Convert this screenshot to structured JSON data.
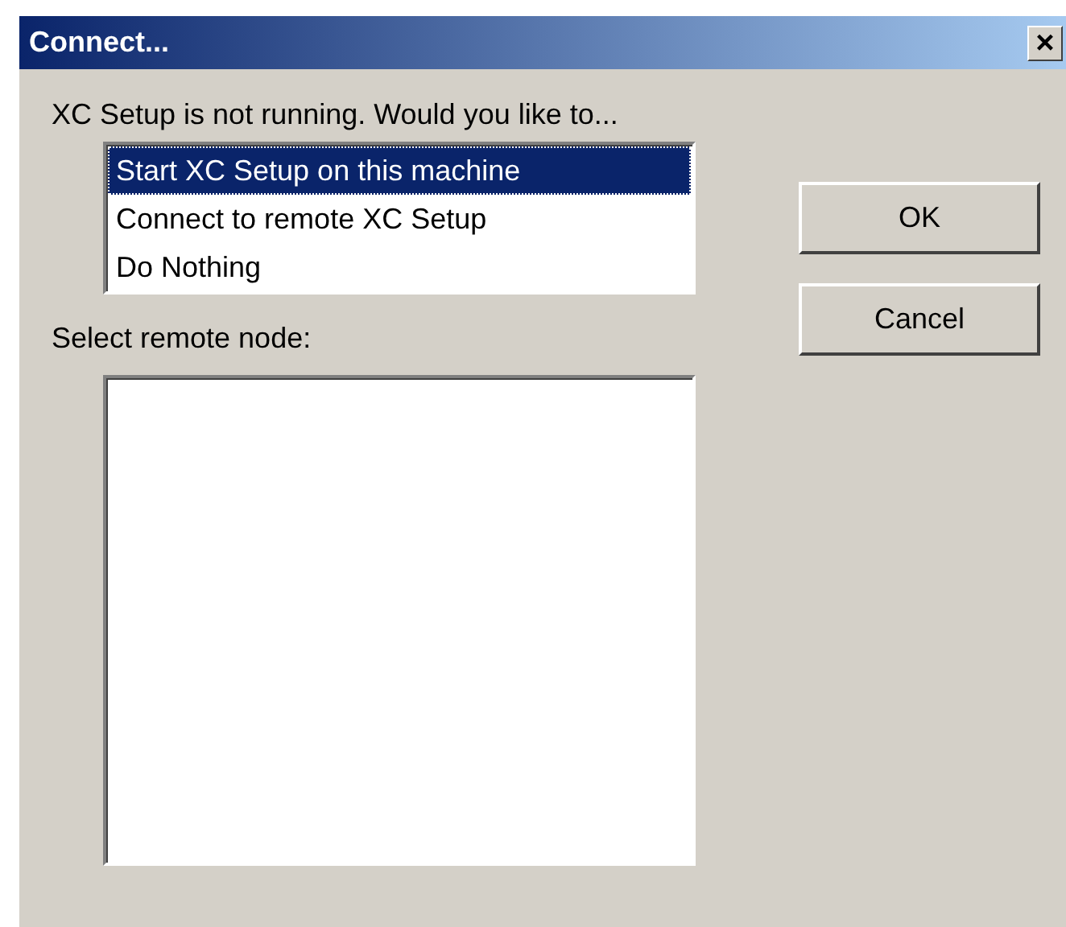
{
  "window": {
    "title": "Connect...",
    "close": "×"
  },
  "prompt": "XC Setup is not running.  Would you like to...",
  "options": [
    {
      "label": "Start XC Setup on this machine",
      "selected": true
    },
    {
      "label": "Connect to remote XC Setup",
      "selected": false
    },
    {
      "label": "Do Nothing",
      "selected": false
    }
  ],
  "node_label": "Select remote node:",
  "buttons": [
    "OK",
    "Cancel"
  ]
}
